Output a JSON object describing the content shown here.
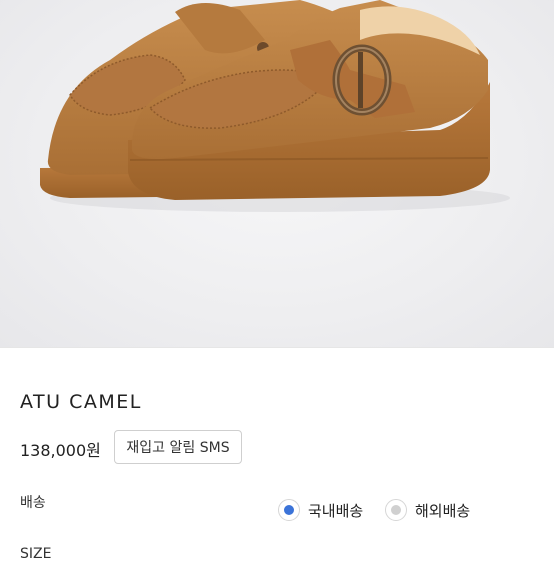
{
  "product": {
    "name": "ATU CAMEL",
    "price": "138,000원",
    "restock_button": "재입고 알림 SMS"
  },
  "options": {
    "shipping_label": "배송",
    "shipping_choices": [
      {
        "label": "국내배송",
        "selected": true
      },
      {
        "label": "해외배송",
        "selected": false
      }
    ],
    "size_label": "SIZE"
  },
  "colors": {
    "selected_radio": "#3b73d8",
    "unselected_radio": "#d0d0d0",
    "suede": "#b57a3e"
  },
  "image": {
    "icon": "product-photo-camel-suede-clogs"
  }
}
